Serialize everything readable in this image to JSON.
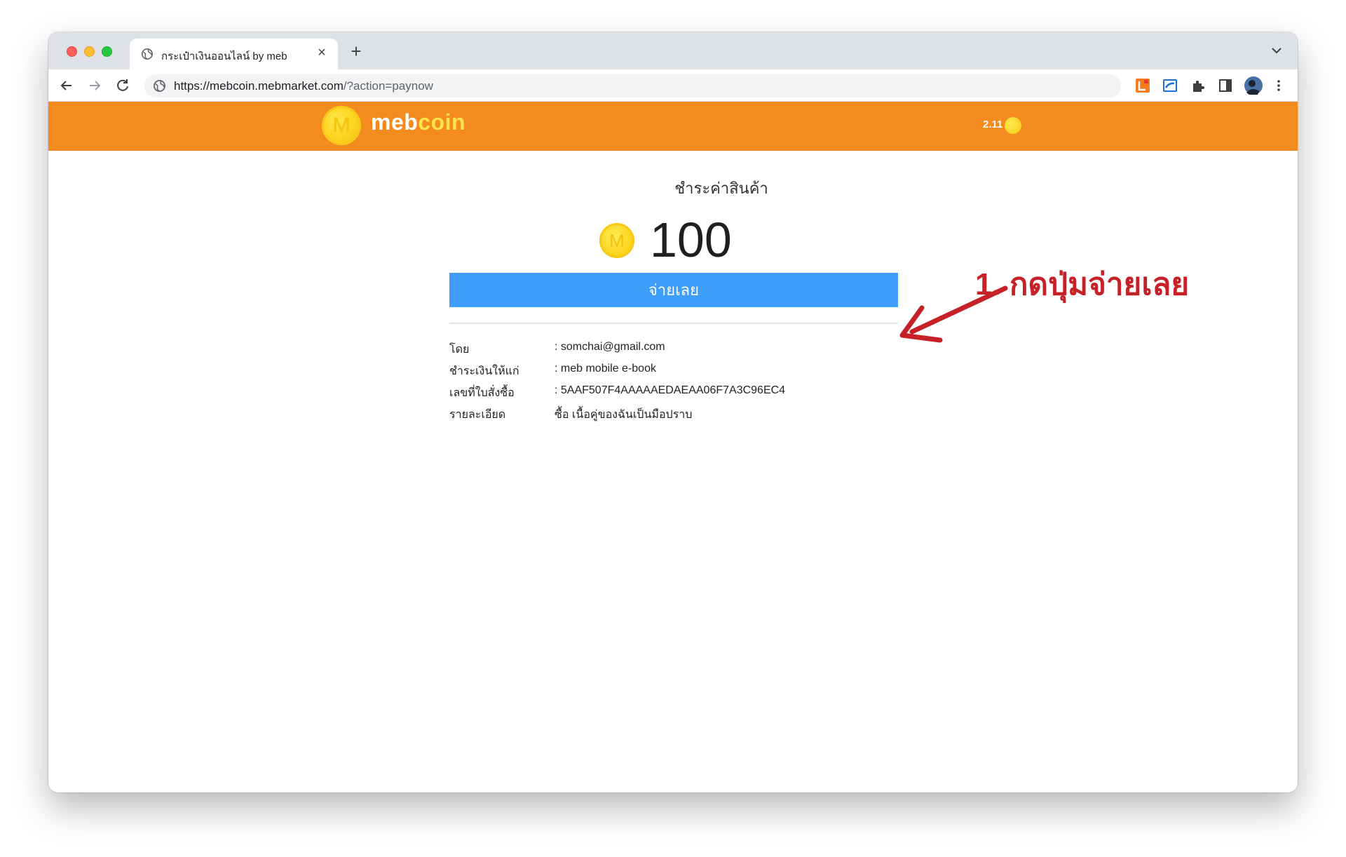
{
  "browser": {
    "tab_title": "กระเป๋าเงินออนไลน์ by meb",
    "tab_close": "×",
    "new_tab": "+",
    "url_host": "https://mebcoin.mebmarket.com",
    "url_path": "/?action=paynow"
  },
  "header": {
    "logo_coin_letter": "M",
    "logo_text_meb": "meb",
    "logo_text_coin": "coin",
    "balance": "2.11"
  },
  "payment": {
    "heading": "ชำระค่าสินค้า",
    "coin_letter": "M",
    "amount": "100",
    "pay_button_label": "จ่ายเลย"
  },
  "details": [
    {
      "label": "โดย",
      "value": ": somchai@gmail.com"
    },
    {
      "label": "ชำระเงินให้แก่",
      "value": ": meb mobile e-book"
    },
    {
      "label": "เลขที่ใบสั่งซื้อ",
      "value": ": 5AAF507F4AAAAAEDAEAA06F7A3C96EC4"
    },
    {
      "label": "รายละเอียด",
      "value": "ซื้อ เนื้อคู่ของฉันเป็นมือปราบ"
    }
  ],
  "annotation": {
    "text": "1. กดปุ่มจ่ายเลย",
    "color": "#c62127"
  },
  "colors": {
    "header_bg": "#f48b1f",
    "pay_button_bg": "#3f9ef9",
    "coin": "#fcd41e"
  }
}
